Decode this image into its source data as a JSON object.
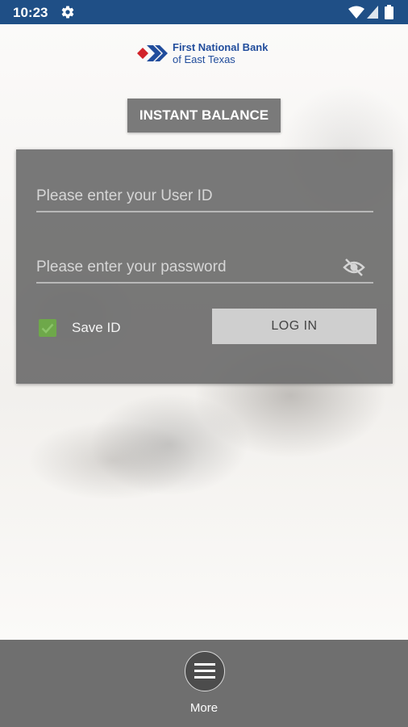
{
  "status_bar": {
    "time": "10:23"
  },
  "logo": {
    "line1": "First National Bank",
    "line2": "of East Texas"
  },
  "instant_balance": {
    "label": "INSTANT BALANCE"
  },
  "login": {
    "user_placeholder": "Please enter your User ID",
    "password_placeholder": "Please enter your password",
    "save_id_label": "Save ID",
    "save_id_checked": true,
    "login_label": "LOG IN"
  },
  "bottom_nav": {
    "more_label": "More"
  },
  "colors": {
    "status_bar": "#1f4f86",
    "brand_blue": "#214d9c",
    "brand_red": "#d2232a",
    "checkbox_green": "#6ea84a"
  }
}
